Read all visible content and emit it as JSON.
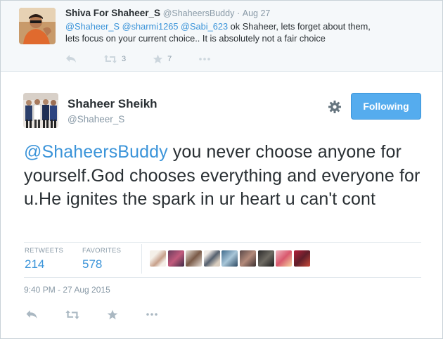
{
  "reply_tweet": {
    "name": "Shiva For Shaheer_S",
    "handle": "@ShaheersBuddy",
    "separator": "·",
    "time": "Aug 27",
    "mentions": [
      "@Shaheer_S",
      "@sharmi1265",
      "@Sabi_623"
    ],
    "text_after_mentions": " ok Shaheer, lets forget about them,",
    "text_line2": "lets focus on your current choice.. It is absolutely not a fair choice",
    "retweet_count": "3",
    "favorite_count": "7",
    "icons": [
      "reply-icon",
      "retweet-icon",
      "favorite-icon",
      "more-icon"
    ]
  },
  "main_tweet": {
    "name": "Shaheer Sheikh",
    "handle": "@Shaheer_S",
    "follow_label": "Following",
    "mention": "@ShaheersBuddy",
    "text": " you never choose anyone for yourself.God chooses everything and everyone for u.He ignites the spark in ur heart u can't cont",
    "retweets_label": "RETWEETS",
    "retweets_value": "214",
    "favorites_label": "FAVORITES",
    "favorites_value": "578",
    "timestamp": "9:40 PM - 27 Aug 2015",
    "icons": [
      "gear-icon",
      "reply-icon",
      "retweet-icon",
      "favorite-icon",
      "more-icon"
    ]
  },
  "colors": {
    "link": "#3b94d9",
    "follow_button": "#55acee",
    "muted": "#8899a6",
    "reply_background": "#f5f8fa"
  }
}
